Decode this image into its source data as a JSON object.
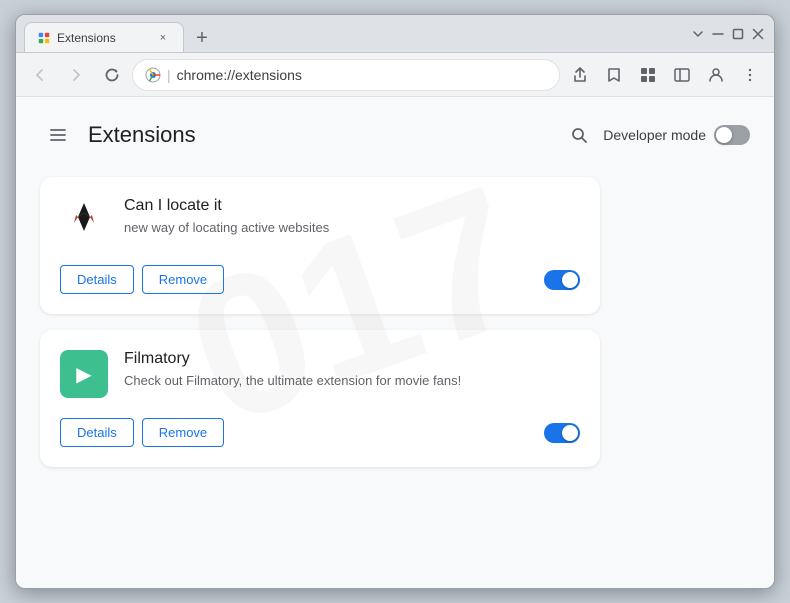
{
  "window": {
    "title": "Extensions",
    "tab_title": "Extensions",
    "tab_close_label": "×",
    "new_tab_label": "+",
    "controls": {
      "minimize": "—",
      "maximize": "☐",
      "close": "✕",
      "chevron_down": "⌄"
    }
  },
  "toolbar": {
    "back_tooltip": "Back",
    "forward_tooltip": "Forward",
    "reload_tooltip": "Reload",
    "chrome_label": "Chrome",
    "address": "chrome://extensions",
    "separator": "|"
  },
  "extensions_page": {
    "title": "Extensions",
    "developer_mode_label": "Developer mode",
    "developer_mode_on": false,
    "extensions": [
      {
        "id": "can-i-locate-it",
        "name": "Can I locate it",
        "description": "new way of locating active websites",
        "enabled": true,
        "details_label": "Details",
        "remove_label": "Remove"
      },
      {
        "id": "filmatory",
        "name": "Filmatory",
        "description": "Check out Filmatory, the ultimate extension for movie fans!",
        "enabled": true,
        "details_label": "Details",
        "remove_label": "Remove"
      }
    ]
  }
}
